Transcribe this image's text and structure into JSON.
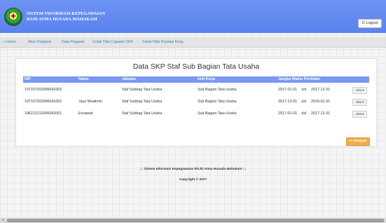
{
  "header": {
    "title_line1": "SISTEM INFORMASI KEPEGAWAIAN",
    "title_line2": "RSJD ATMA HUSADA MAHAKAM",
    "logo_icon": "hospital-emblem",
    "logout_label": "Logout",
    "logout_icon": "power-icon"
  },
  "nav": {
    "items": [
      {
        "label": "Home",
        "icon": "home-icon"
      },
      {
        "label": "Akun Pegawai"
      },
      {
        "label": "Data Pegawai"
      },
      {
        "label": "Cetak Nilai Capaian SKP"
      },
      {
        "label": "Cetak Nilai Prestasi Kerja"
      }
    ]
  },
  "main": {
    "title": "Data SKP Staf Sub Bagian Tata Usaha",
    "columns": [
      "NIP",
      "Nama",
      "Jabatan",
      "Unit Kerja",
      "Jangka Waktu Penilaian"
    ],
    "rows": [
      {
        "nip": "197107202006041002",
        "nama": "",
        "jabatan": "Staf Subbag Tata Usaha",
        "unit": "Sub Bagian Tata Usaha",
        "start": "2017-01-01",
        "sd": "s/d",
        "end": "2017-12-31",
        "aksi": "Aksi"
      },
      {
        "nip": "197107202006041002",
        "nama": "Jaya Mualimin",
        "jabatan": "Staf Subbag Tata Usaha",
        "unit": "Sub Bagian Tata Usaha",
        "start": "2017-12-01",
        "sd": "s/d",
        "end": "2018-01-31",
        "aksi": "Aksi"
      },
      {
        "nip": "196212212006042001",
        "nama": "Ernawati",
        "jabatan": "Staf Subbag Tata Usaha",
        "unit": "Sub Bagian Tata Usaha",
        "start": "2017-01-01",
        "sd": "s/d",
        "end": "2017-12-31",
        "aksi": "Aksi"
      }
    ],
    "kembali_label": "Kembali",
    "kembali_icon": "back-arrow-icon"
  },
  "footer": {
    "line1": ".:: Sistem Informasi Kepegawaian RSJD Atma Husada Mahakam ::.",
    "line2": "Copyright © 2017"
  },
  "colors": {
    "header_bg": "#5a83ee",
    "table_header_bg": "#7a98ee",
    "link": "#3b7ec4",
    "kembali_bg": "#f0ad4e"
  }
}
